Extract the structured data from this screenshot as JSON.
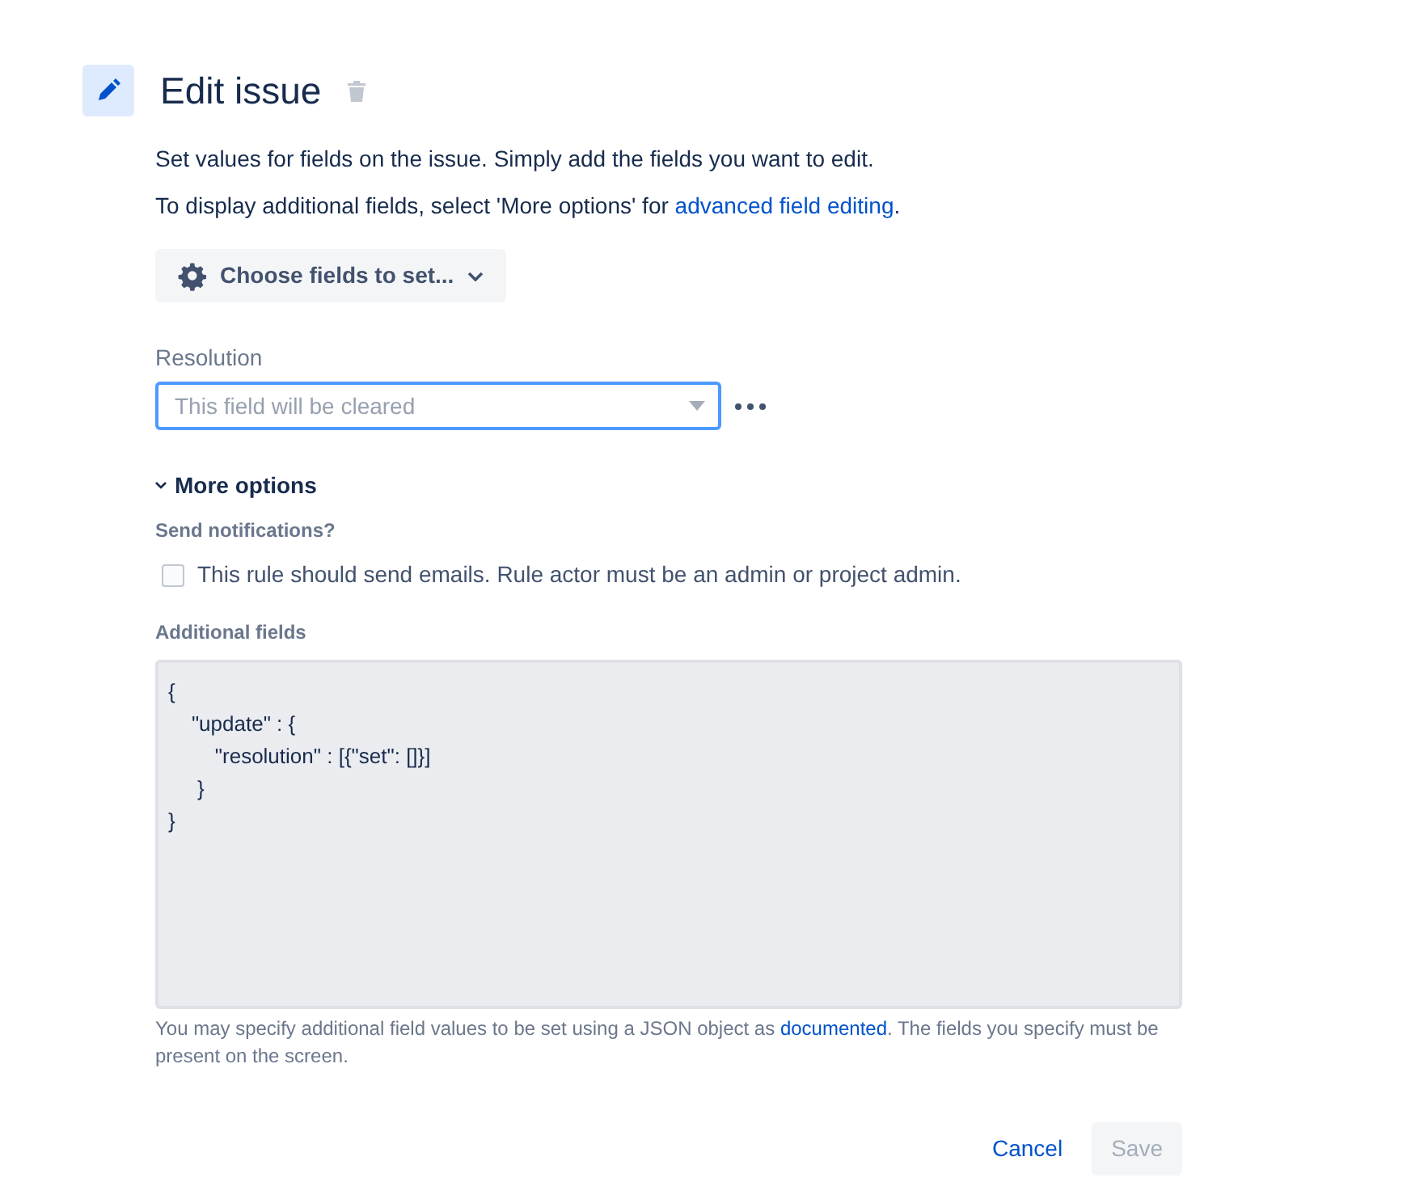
{
  "header": {
    "title": "Edit issue"
  },
  "intro": "Set values for fields on the issue. Simply add the fields you want to edit.",
  "advanced_note": {
    "text_before": "To display additional fields, select 'More options' for ",
    "link": "advanced field editing",
    "text_after": "."
  },
  "choose_fields_button": {
    "label": "Choose fields to set..."
  },
  "resolution": {
    "label": "Resolution",
    "placeholder": "This field will be cleared",
    "focused": true
  },
  "more_options": {
    "label": "More options",
    "expanded": true,
    "send_notifications": {
      "label": "Send notifications?",
      "checkbox_label": "This rule should send emails. Rule actor must be an admin or project admin.",
      "checked": false
    },
    "additional_fields": {
      "label": "Additional fields",
      "value": "{\n    \"update\" : {\n        \"resolution\" : [{\"set\": []}]\n     }\n}",
      "help": {
        "text_before": "You may specify additional field values to be set using a JSON object as ",
        "link": "documented",
        "text_after": ". The fields you specify must be present on the screen."
      }
    }
  },
  "buttons": [
    {
      "label": "Cancel",
      "kind": "link",
      "disabled": false
    },
    {
      "label": "Save",
      "kind": "primary",
      "disabled": true
    }
  ]
}
